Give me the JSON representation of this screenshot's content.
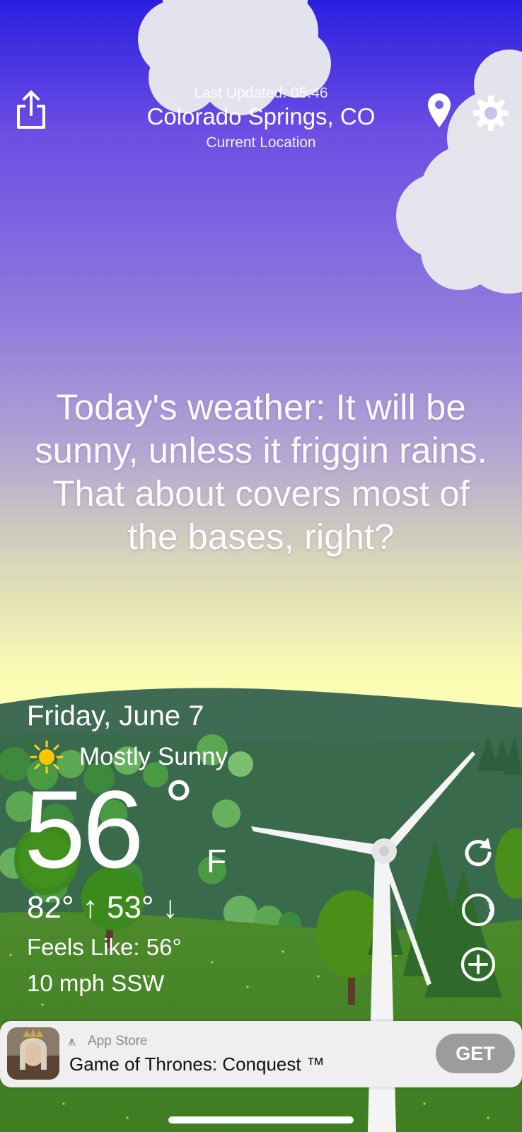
{
  "header": {
    "last_updated": "Last Updated: 05:46",
    "location": "Colorado Springs, CO",
    "location_sub": "Current Location",
    "share_icon": "share-icon",
    "pin_icon": "location-pin-icon",
    "settings_icon": "gear-icon"
  },
  "message": "Today's weather: It will be sunny, unless it friggin rains. That about covers most of the bases, right?",
  "current": {
    "date": "Friday, June 7",
    "condition": "Mostly Sunny",
    "condition_icon": "sun-icon",
    "temperature": "56",
    "degree": "°",
    "unit": "F",
    "high_low": "82° ↑ 53° ↓",
    "feels_like": "Feels Like: 56°",
    "wind": "10 mph SSW"
  },
  "side_buttons": [
    {
      "icon": "refresh-icon"
    },
    {
      "icon": "moon-icon"
    },
    {
      "icon": "add-icon"
    }
  ],
  "ad": {
    "store_label": "App Store",
    "title": "Game of Thrones: Conquest ™",
    "cta": "GET"
  },
  "colors": {
    "sky_top": "#2a1fe0",
    "sky_mid": "#9a86d8",
    "sky_horizon": "#fbfdb4",
    "hills": "#3d6a52",
    "grass": "#4f8a2a"
  }
}
